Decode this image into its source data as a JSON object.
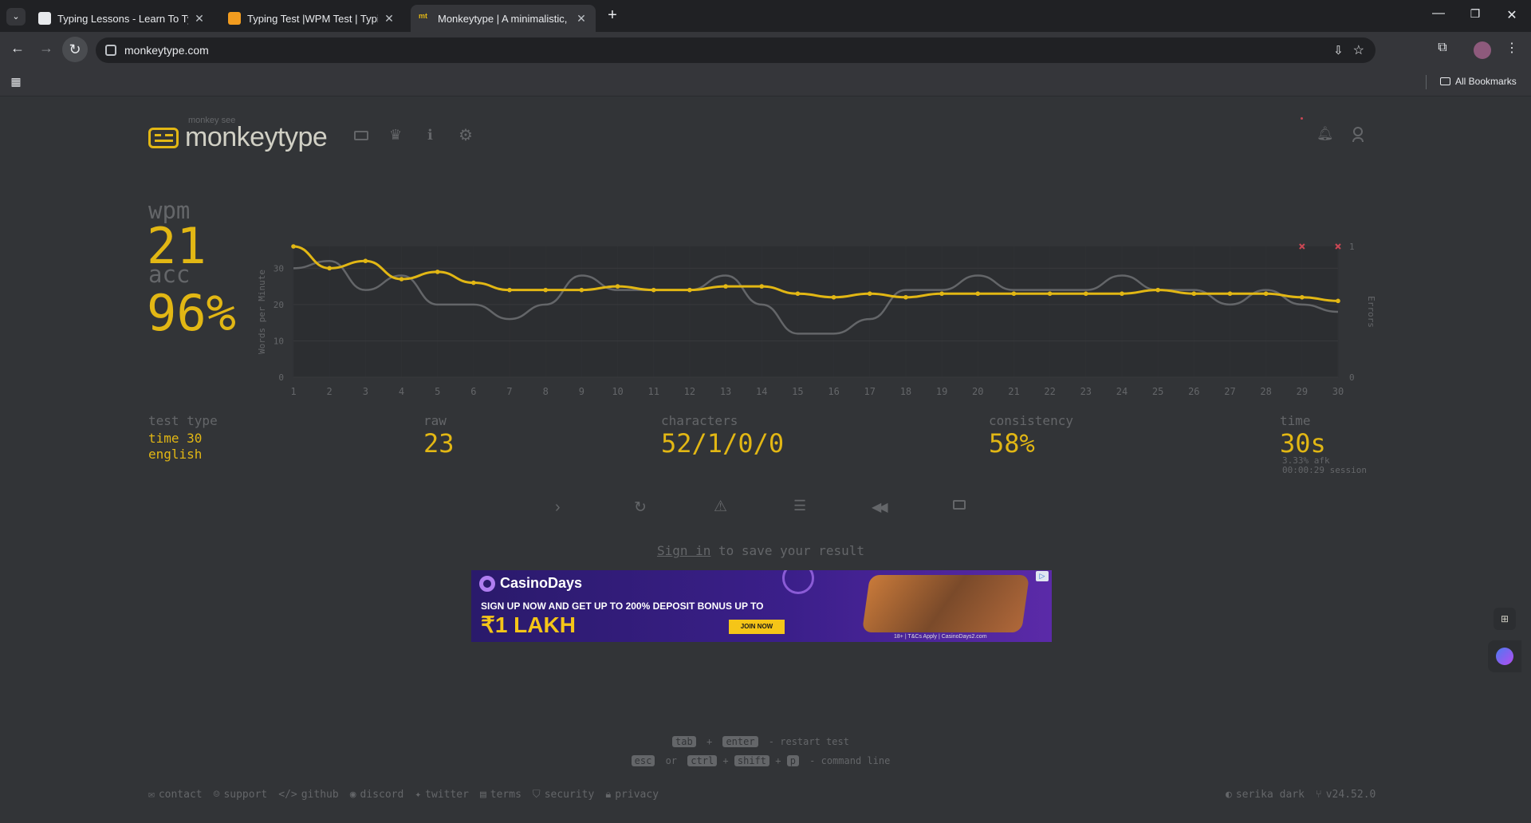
{
  "browser": {
    "tabs": [
      {
        "title": "Typing Lessons - Learn To Type"
      },
      {
        "title": "Typing Test |WPM Test | Typing"
      },
      {
        "title": "Monkeytype | A minimalistic, cu"
      }
    ],
    "url": "monkeytype.com",
    "bookmarks_label": "All Bookmarks"
  },
  "header": {
    "logo_small": "monkey see",
    "logo_text": "monkeytype"
  },
  "result": {
    "wpm_label": "wpm",
    "wpm_value": "21",
    "acc_label": "acc",
    "acc_value": "96%",
    "test_type_label": "test type",
    "test_type_mode": "time 30",
    "test_type_lang": "english",
    "raw_label": "raw",
    "raw_value": "23",
    "characters_label": "characters",
    "characters_value": "52/1/0/0",
    "consistency_label": "consistency",
    "consistency_value": "58%",
    "time_label": "time",
    "time_value": "30s",
    "afk": "3.33% afk",
    "session": "00:00:29 session",
    "signin_link": "Sign in",
    "signin_rest": " to save your result"
  },
  "chart_data": {
    "type": "line",
    "x": [
      1,
      2,
      3,
      4,
      5,
      6,
      7,
      8,
      9,
      10,
      11,
      12,
      13,
      14,
      15,
      16,
      17,
      18,
      19,
      20,
      21,
      22,
      23,
      24,
      25,
      26,
      27,
      28,
      29,
      30
    ],
    "series": [
      {
        "name": "wpm",
        "color": "#e2b714",
        "values": [
          36,
          30,
          32,
          27,
          29,
          26,
          24,
          24,
          24,
          25,
          24,
          24,
          25,
          25,
          23,
          22,
          23,
          22,
          23,
          23,
          23,
          23,
          23,
          23,
          24,
          23,
          23,
          23,
          22,
          21
        ]
      },
      {
        "name": "raw",
        "color": "#646669",
        "values": [
          30,
          32,
          24,
          28,
          20,
          20,
          16,
          20,
          28,
          24,
          24,
          24,
          28,
          20,
          12,
          12,
          16,
          24,
          24,
          28,
          24,
          24,
          24,
          28,
          24,
          24,
          20,
          24,
          20,
          18
        ]
      }
    ],
    "errors": [
      {
        "x": 29,
        "value": 1
      },
      {
        "x": 30,
        "value": 1
      }
    ],
    "ylabel": "Words per Minute",
    "y2label": "Errors",
    "yticks": [
      0,
      10,
      20,
      30
    ],
    "y2ticks": [
      0,
      1
    ],
    "ylim": [
      0,
      36
    ],
    "grid": true
  },
  "ad": {
    "brand": "CasinoDays",
    "line1": "SIGN UP NOW AND GET UP TO 200% DEPOSIT BONUS UP TO",
    "line2": "₹1 LAKH",
    "cta": "JOIN NOW",
    "fineprint": "18+ | T&Cs Apply | CasinoDays2.com"
  },
  "hints": {
    "k_tab": "tab",
    "plus": "+",
    "k_enter": "enter",
    "restart": "- restart test",
    "k_esc": "esc",
    "or": "or",
    "k_ctrl": "ctrl",
    "k_shift": "shift",
    "k_p": "p",
    "cmdline": "- command line"
  },
  "footer": {
    "links": [
      "contact",
      "support",
      "github",
      "discord",
      "twitter",
      "terms",
      "security",
      "privacy"
    ],
    "theme": "serika dark",
    "version": "v24.52.0"
  },
  "colors": {
    "main": "#e2b714",
    "bg": "#323437",
    "sub": "#646669",
    "text": "#d1d0c5",
    "error": "#ca4754"
  }
}
